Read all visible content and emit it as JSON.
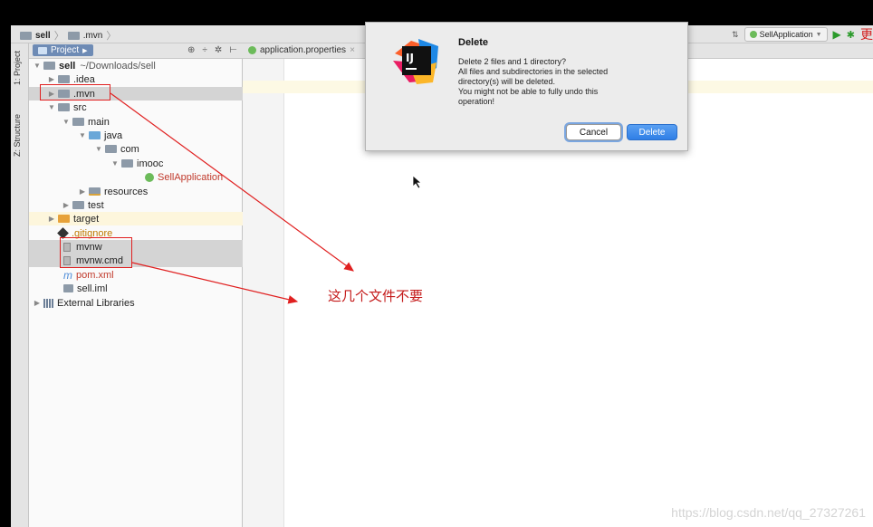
{
  "breadcrumb": {
    "root": "sell",
    "child": ".mvn"
  },
  "toolbar": {
    "run_config": "SellApplication",
    "right_char": "更"
  },
  "tool_windows": {
    "project_tab": "1: Project",
    "structure_tab": "Z: Structure"
  },
  "project_panel": {
    "button_label": "Project"
  },
  "editor": {
    "tab_label": "application.properties"
  },
  "tree": [
    {
      "label": "sell",
      "suffix": "~/Downloads/sell"
    },
    {
      "label": ".idea"
    },
    {
      "label": ".mvn"
    },
    {
      "label": "src"
    },
    {
      "label": "main"
    },
    {
      "label": "java"
    },
    {
      "label": "com"
    },
    {
      "label": "imooc"
    },
    {
      "label": "SellApplication"
    },
    {
      "label": "resources"
    },
    {
      "label": "test"
    },
    {
      "label": "target"
    },
    {
      "label": ".gitignore"
    },
    {
      "label": "mvnw"
    },
    {
      "label": "mvnw.cmd"
    },
    {
      "label": "pom.xml"
    },
    {
      "label": "sell.iml"
    },
    {
      "label": "External Libraries"
    }
  ],
  "dialog": {
    "title": "Delete",
    "lines": [
      "Delete 2 files and 1 directory?",
      "All files and subdirectories in the selected",
      "directory(s) will be deleted.",
      "You might not be able to fully undo this",
      "operation!"
    ],
    "cancel_label": "Cancel",
    "delete_label": "Delete",
    "logo_text": "IJ"
  },
  "annotation": {
    "note": "这几个文件不要",
    "color": "#c41a1a"
  },
  "watermark": "https://blog.csdn.net/qq_27327261",
  "colors": {
    "accent": "#2f7fe6",
    "selection": "#d4d4d4",
    "highlight": "#fdf6dc"
  }
}
